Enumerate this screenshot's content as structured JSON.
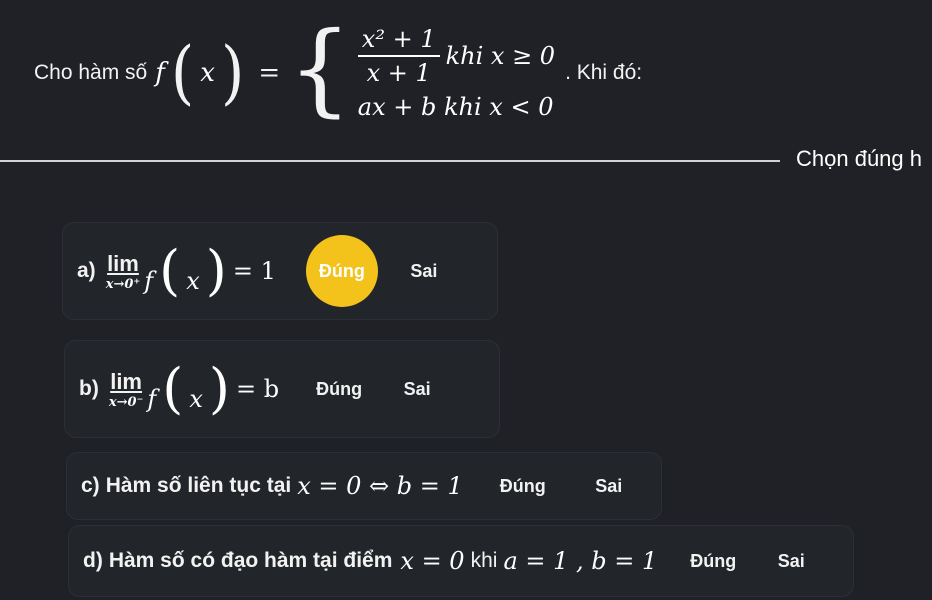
{
  "question": {
    "intro": "Cho hàm số",
    "f": "f",
    "x": "x",
    "case1_num": "x² + 1",
    "case1_den": "x + 1",
    "case1_cond": "khi x ≥ 0",
    "case2": "ax + b khi x < 0",
    "tail": ". Khi đó:"
  },
  "select_label": "Chọn đúng h",
  "colors": {
    "selected": "#f3c21b",
    "background": "#1f2126"
  },
  "statements": [
    {
      "label": "a)",
      "lim_top": "lim",
      "lim_sub": "x→0⁺",
      "rhs": "= 1",
      "dung": "Đúng",
      "sai": "Sai",
      "selected": "Đúng"
    },
    {
      "label": "b)",
      "lim_top": "lim",
      "lim_sub": "x→0⁻",
      "rhs": "= b",
      "dung": "Đúng",
      "sai": "Sai",
      "selected": ""
    },
    {
      "label": "c)",
      "text": "Hàm số liên tục tại",
      "math": "x = 0 ⇔ b = 1",
      "dung": "Đúng",
      "sai": "Sai",
      "selected": ""
    },
    {
      "label": "d)",
      "text": "Hàm số có đạo hàm tại điểm",
      "math1": "x = 0",
      "text2": "khi",
      "math2": "a = 1 , b = 1",
      "dung": "Đúng",
      "sai": "Sai",
      "selected": ""
    }
  ]
}
